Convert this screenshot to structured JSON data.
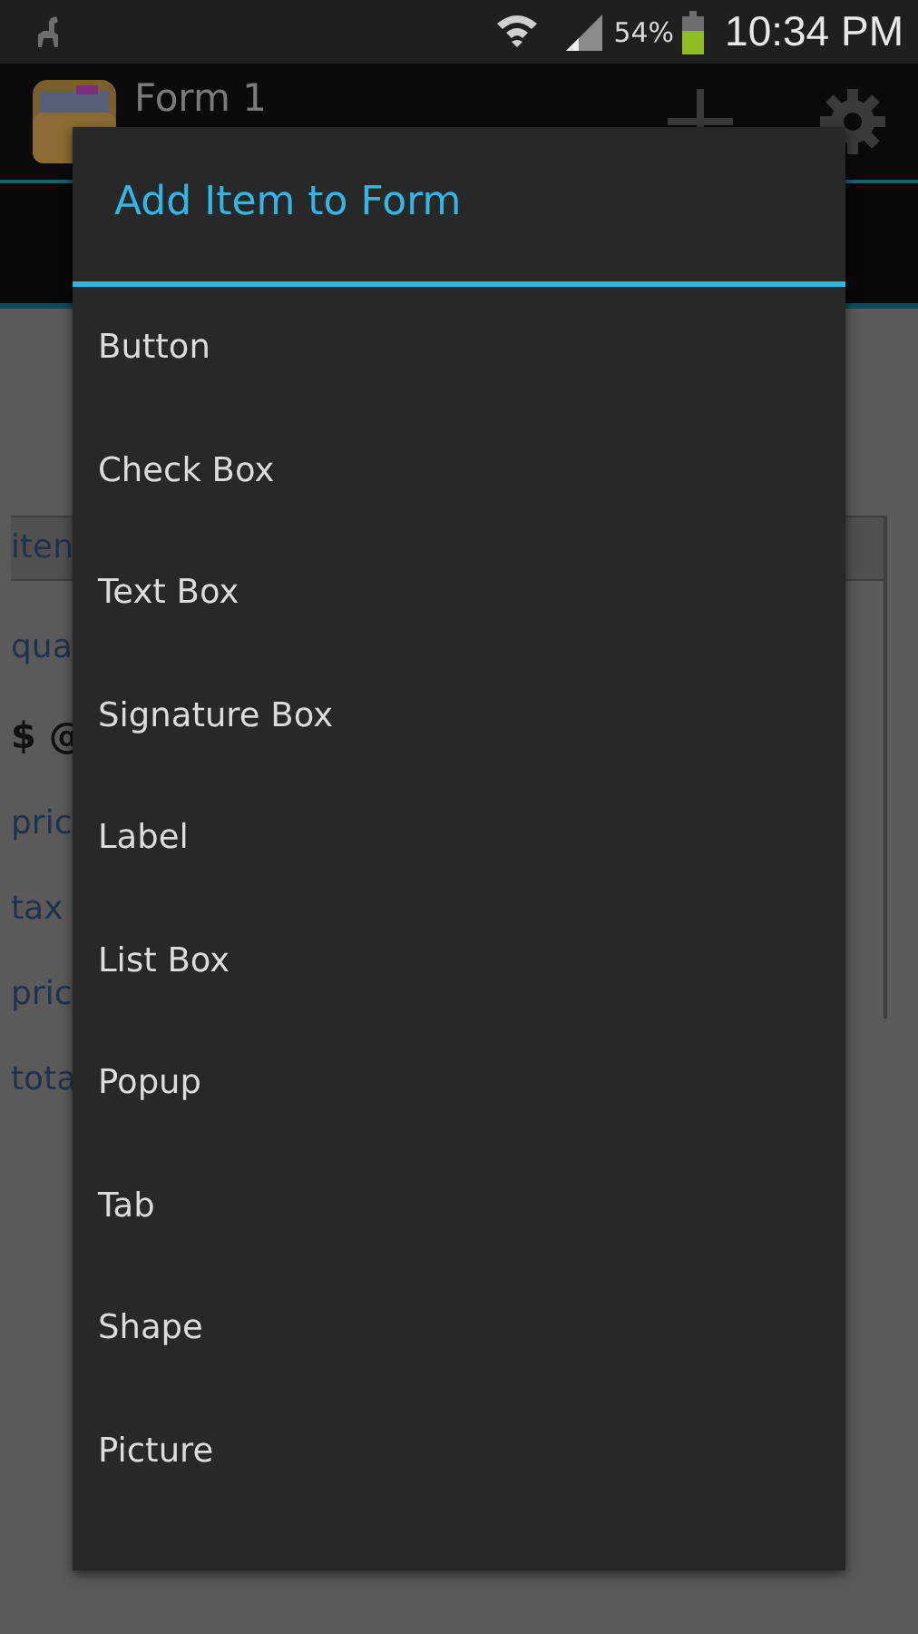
{
  "status_bar": {
    "battery": "54%",
    "time": "10:34 PM"
  },
  "app_bar": {
    "title": "Form 1"
  },
  "form_fragments": [
    {
      "text": "iten",
      "kind": "field"
    },
    {
      "text": "qua",
      "kind": "link"
    },
    {
      "text": "$ @",
      "kind": "bold"
    },
    {
      "text": "pric",
      "kind": "link"
    },
    {
      "text": "tax",
      "kind": "link"
    },
    {
      "text": "pric",
      "kind": "link"
    },
    {
      "text": "tota",
      "kind": "link"
    }
  ],
  "dialog": {
    "title": "Add Item to Form",
    "items": [
      "Button",
      "Check Box",
      "Text Box",
      "Signature Box",
      "Label",
      "List Box",
      "Popup",
      "Tab",
      "Shape",
      "Picture"
    ]
  }
}
